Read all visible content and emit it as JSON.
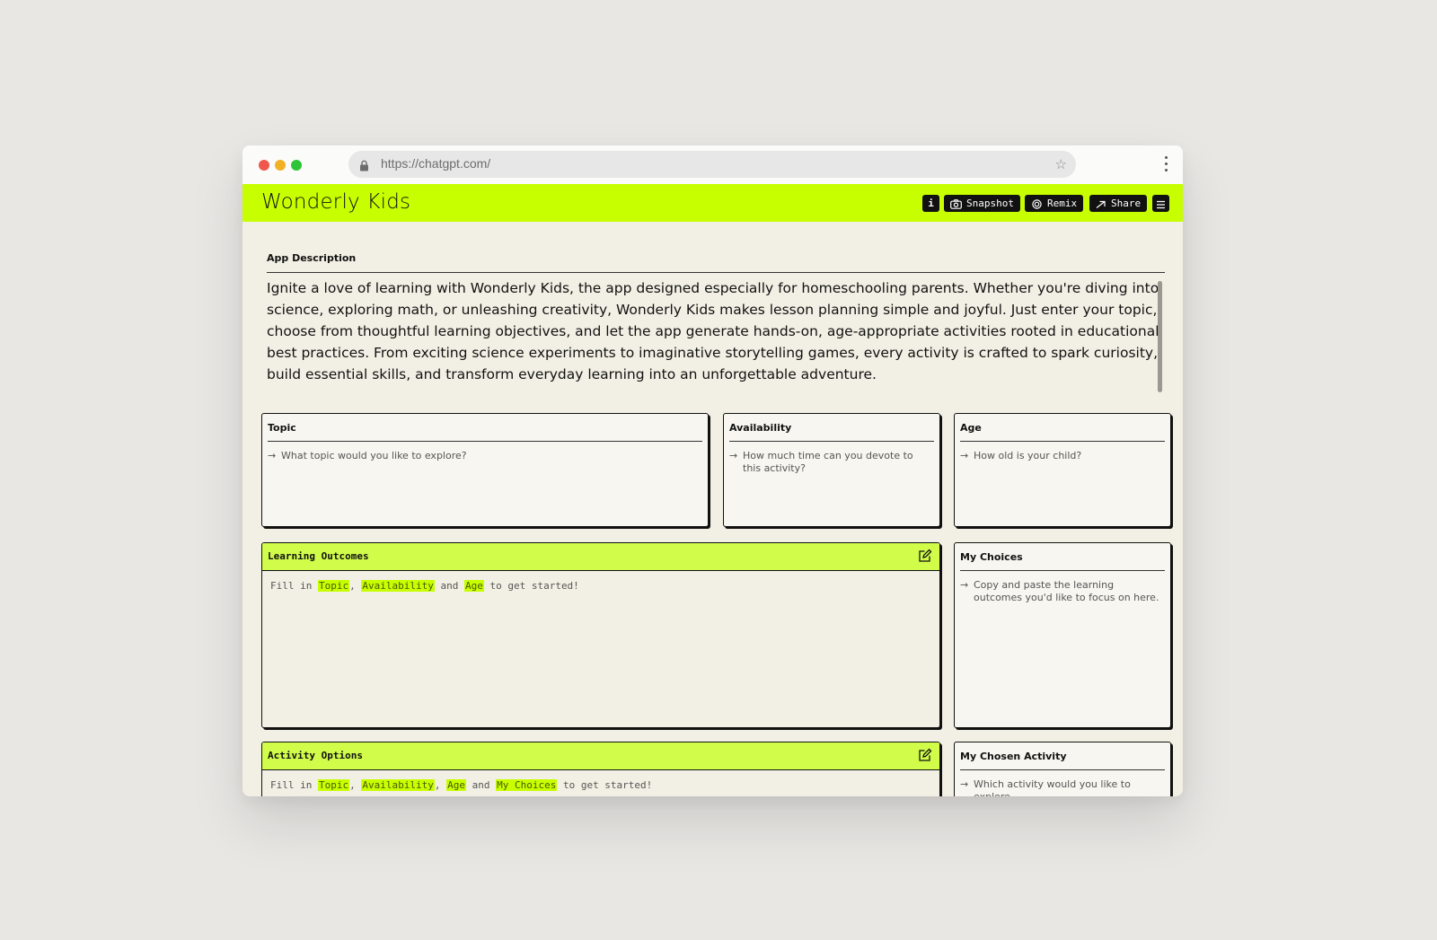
{
  "browser": {
    "url": "https://chatgpt.com/"
  },
  "app": {
    "title": "Wonderly Kids",
    "toolbar": {
      "info_label": "i",
      "snapshot_label": "Snapshot",
      "remix_label": "Remix",
      "share_label": "Share"
    }
  },
  "description": {
    "label": "App Description",
    "text": "Ignite a love of learning with Wonderly Kids, the app designed especially for homeschooling parents. Whether you're diving into science, exploring math, or unleashing creativity, Wonderly Kids makes lesson planning simple and joyful. Just enter your topic, choose from thoughtful learning objectives, and let the app generate hands-on, age-appropriate activities rooted in educational best practices. From exciting science experiments to imaginative storytelling games, every activity is crafted to spark curiosity, build essential skills, and transform everyday learning into an unforgettable adventure."
  },
  "inputs": {
    "topic": {
      "label": "Topic",
      "hint": "What topic would you like to explore?"
    },
    "availability": {
      "label": "Availability",
      "hint": "How much time can you devote to this activity?"
    },
    "age": {
      "label": "Age",
      "hint": "How old is your child?"
    },
    "my_choices": {
      "label": "My Choices",
      "hint": "Copy and paste the learning outcomes you'd like to focus on here."
    },
    "my_chosen_activity": {
      "label": "My Chosen Activity",
      "hint": "Which activity would you like to explore"
    }
  },
  "outputs": {
    "learning_outcomes": {
      "title": "Learning Outcomes",
      "fill_in": "Fill in",
      "topic": "Topic",
      "comma": ",",
      "availability": "Availability",
      "and": "and",
      "age": "Age",
      "tail": "to get started!"
    },
    "activity_options": {
      "title": "Activity Options",
      "fill_in": "Fill in",
      "topic": "Topic",
      "comma1": ",",
      "availability": "Availability",
      "comma2": ",",
      "age": "Age",
      "and": "and",
      "my_choices": "My Choices",
      "tail": "to get started!"
    }
  },
  "icons": {
    "lock": "lock-icon",
    "star": "star-icon",
    "camera": "camera-icon",
    "remix": "remix-icon",
    "share": "arrow-right-icon",
    "menu": "hamburger-icon",
    "edit": "edit-icon",
    "arrow": "arrow-right-icon"
  },
  "colors": {
    "accent": "#c8ff00",
    "panel_header": "#d1fc4a",
    "background": "#f2f0e4"
  }
}
